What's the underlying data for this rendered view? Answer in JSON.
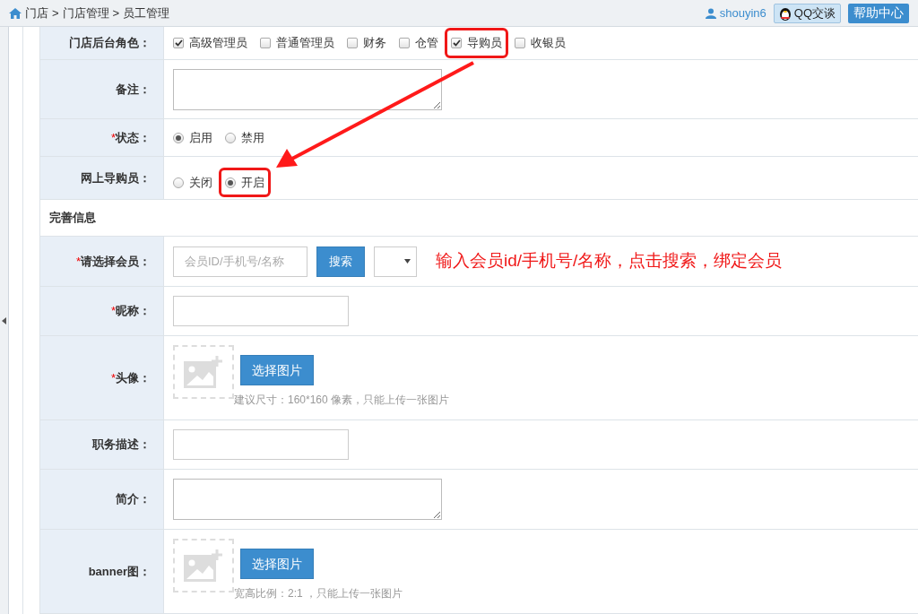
{
  "breadcrumb": [
    "门店",
    "门店管理",
    "员工管理"
  ],
  "breadcrumb_separator": ">",
  "user": "shouyin6",
  "qq_button": "QQ交谈",
  "help_button": "帮助中心",
  "annotation_text": "输入会员id/手机号/名称，点击搜索，绑定会员",
  "form_rows": [
    {
      "kind": "checkboxes",
      "label": "门店后台角色：",
      "options": [
        {
          "label": "高级管理员",
          "checked": true,
          "highlighted": false
        },
        {
          "label": "普通管理员",
          "checked": false,
          "highlighted": false
        },
        {
          "label": "财务",
          "checked": false,
          "highlighted": false
        },
        {
          "label": "仓管",
          "checked": false,
          "highlighted": false
        },
        {
          "label": "导购员",
          "checked": true,
          "highlighted": true
        },
        {
          "label": "收银员",
          "checked": false,
          "highlighted": false
        }
      ]
    },
    {
      "kind": "textarea",
      "label": "备注："
    },
    {
      "kind": "radios",
      "label": "状态：",
      "required_mark": "*",
      "options": [
        {
          "label": "启用",
          "selected": true,
          "highlighted": false
        },
        {
          "label": "禁用",
          "selected": false,
          "highlighted": false
        }
      ]
    },
    {
      "kind": "radios",
      "label": "网上导购员：",
      "options": [
        {
          "label": "关闭",
          "selected": false,
          "highlighted": false
        },
        {
          "label": "开启",
          "selected": true,
          "highlighted": true
        }
      ]
    },
    {
      "kind": "section",
      "label": "完善信息"
    },
    {
      "kind": "member_search",
      "label": "请选择会员：",
      "required_mark": "*",
      "placeholder": "会员ID/手机号/名称",
      "button": "搜索"
    },
    {
      "kind": "text",
      "label": "昵称：",
      "required_mark": "*"
    },
    {
      "kind": "image_upload",
      "label": "头像：",
      "required_mark": "*",
      "button": "选择图片",
      "hint": "建议尺寸：160*160 像素，只能上传一张图片"
    },
    {
      "kind": "text",
      "label": "职务描述："
    },
    {
      "kind": "textarea",
      "label": "简介："
    },
    {
      "kind": "image_upload",
      "label": "banner图：",
      "button": "选择图片",
      "hint": "宽高比例：2:1 ，只能上传一张图片"
    }
  ]
}
